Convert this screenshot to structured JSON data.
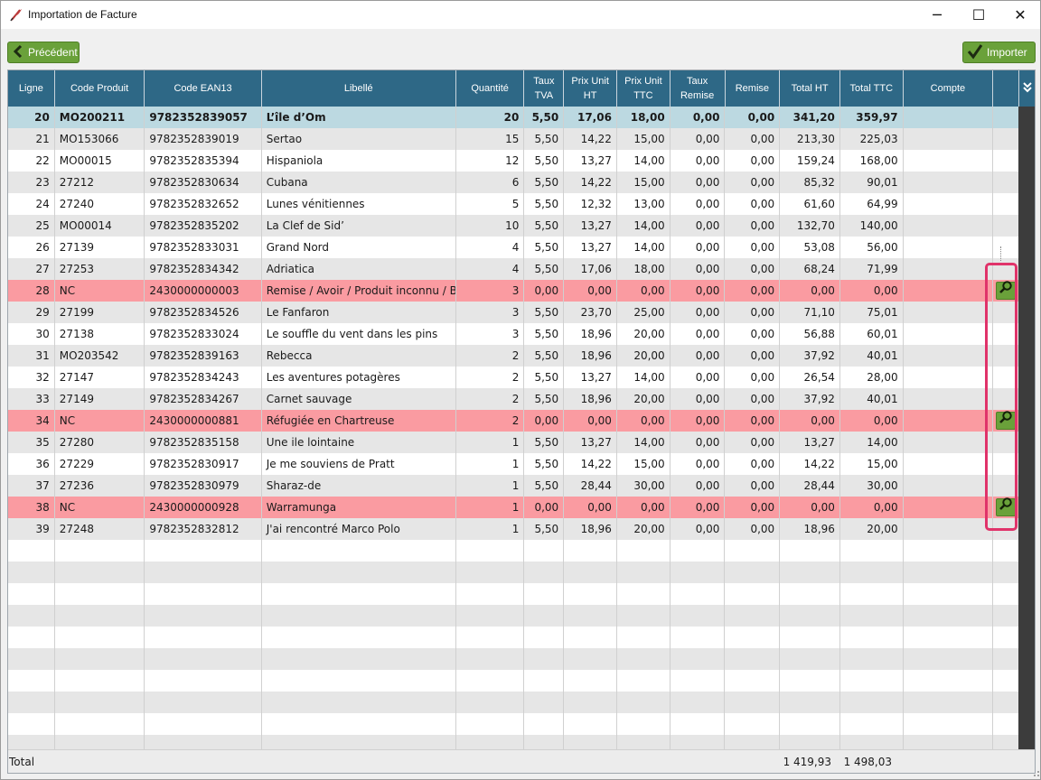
{
  "window": {
    "title": "Importation de Facture",
    "minimize": "─",
    "maximize": "☐",
    "close": "✕"
  },
  "toolbar": {
    "prev_label": "Précédent",
    "import_label": "Importer"
  },
  "colors": {
    "header": "#2e6886",
    "accent_green": "#6aa13a",
    "row_unknown": "#fa9ba1",
    "row_selected": "#bcd9e1",
    "highlight": "#e0336a"
  },
  "grid": {
    "columns": [
      {
        "key": "ligne",
        "label": "Ligne"
      },
      {
        "key": "code",
        "label": "Code Produit"
      },
      {
        "key": "ean",
        "label": "Code EAN13"
      },
      {
        "key": "libelle",
        "label": "Libellé"
      },
      {
        "key": "qte",
        "label": "Quantité"
      },
      {
        "key": "tva",
        "label": "Taux TVA"
      },
      {
        "key": "puht",
        "label": "Prix Unit HT"
      },
      {
        "key": "puttc",
        "label": "Prix Unit TTC"
      },
      {
        "key": "tremise",
        "label": "Taux Remise"
      },
      {
        "key": "remise",
        "label": "Remise"
      },
      {
        "key": "tht",
        "label": "Total HT"
      },
      {
        "key": "tttc",
        "label": "Total TTC"
      },
      {
        "key": "compte",
        "label": "Compte"
      },
      {
        "key": "action",
        "label": ""
      }
    ],
    "rows": [
      {
        "ligne": "20",
        "code": "MO200211",
        "ean": "9782352839057",
        "libelle": "L’île d’Om",
        "qte": "20",
        "tva": "5,50",
        "puht": "17,06",
        "puttc": "18,00",
        "tremise": "0,00",
        "remise": "0,00",
        "tht": "341,20",
        "tttc": "359,97",
        "compte": "",
        "state": "selected",
        "search": false
      },
      {
        "ligne": "21",
        "code": "MO153066",
        "ean": "9782352839019",
        "libelle": "Sertao",
        "qte": "15",
        "tva": "5,50",
        "puht": "14,22",
        "puttc": "15,00",
        "tremise": "0,00",
        "remise": "0,00",
        "tht": "213,30",
        "tttc": "225,03",
        "compte": "",
        "state": "normal",
        "search": false
      },
      {
        "ligne": "22",
        "code": "MO00015",
        "ean": "9782352835394",
        "libelle": "Hispaniola",
        "qte": "12",
        "tva": "5,50",
        "puht": "13,27",
        "puttc": "14,00",
        "tremise": "0,00",
        "remise": "0,00",
        "tht": "159,24",
        "tttc": "168,00",
        "compte": "",
        "state": "normal",
        "search": false
      },
      {
        "ligne": "23",
        "code": "27212",
        "ean": "9782352830634",
        "libelle": "Cubana",
        "qte": "6",
        "tva": "5,50",
        "puht": "14,22",
        "puttc": "15,00",
        "tremise": "0,00",
        "remise": "0,00",
        "tht": "85,32",
        "tttc": "90,01",
        "compte": "",
        "state": "normal",
        "search": false
      },
      {
        "ligne": "24",
        "code": "27240",
        "ean": "9782352832652",
        "libelle": "Lunes vénitiennes",
        "qte": "5",
        "tva": "5,50",
        "puht": "12,32",
        "puttc": "13,00",
        "tremise": "0,00",
        "remise": "0,00",
        "tht": "61,60",
        "tttc": "64,99",
        "compte": "",
        "state": "normal",
        "search": false
      },
      {
        "ligne": "25",
        "code": "MO00014",
        "ean": "9782352835202",
        "libelle": "La Clef de Sid’",
        "qte": "10",
        "tva": "5,50",
        "puht": "13,27",
        "puttc": "14,00",
        "tremise": "0,00",
        "remise": "0,00",
        "tht": "132,70",
        "tttc": "140,00",
        "compte": "",
        "state": "normal",
        "search": false
      },
      {
        "ligne": "26",
        "code": "27139",
        "ean": "9782352833031",
        "libelle": "Grand Nord",
        "qte": "4",
        "tva": "5,50",
        "puht": "13,27",
        "puttc": "14,00",
        "tremise": "0,00",
        "remise": "0,00",
        "tht": "53,08",
        "tttc": "56,00",
        "compte": "",
        "state": "normal",
        "search": false
      },
      {
        "ligne": "27",
        "code": "27253",
        "ean": "9782352834342",
        "libelle": "Adriatica",
        "qte": "4",
        "tva": "5,50",
        "puht": "17,06",
        "puttc": "18,00",
        "tremise": "0,00",
        "remise": "0,00",
        "tht": "68,24",
        "tttc": "71,99",
        "compte": "",
        "state": "normal",
        "search": false
      },
      {
        "ligne": "28",
        "code": "NC",
        "ean": "2430000000003",
        "libelle": "Remise / Avoir / Produit inconnu / Bo",
        "qte": "3",
        "tva": "0,00",
        "puht": "0,00",
        "puttc": "0,00",
        "tremise": "0,00",
        "remise": "0,00",
        "tht": "0,00",
        "tttc": "0,00",
        "compte": "",
        "state": "unknown",
        "search": true
      },
      {
        "ligne": "29",
        "code": "27199",
        "ean": "9782352834526",
        "libelle": "Le Fanfaron",
        "qte": "3",
        "tva": "5,50",
        "puht": "23,70",
        "puttc": "25,00",
        "tremise": "0,00",
        "remise": "0,00",
        "tht": "71,10",
        "tttc": "75,01",
        "compte": "",
        "state": "normal",
        "search": false
      },
      {
        "ligne": "30",
        "code": "27138",
        "ean": "9782352833024",
        "libelle": "Le souffle du vent dans les pins",
        "qte": "3",
        "tva": "5,50",
        "puht": "18,96",
        "puttc": "20,00",
        "tremise": "0,00",
        "remise": "0,00",
        "tht": "56,88",
        "tttc": "60,01",
        "compte": "",
        "state": "normal",
        "search": false
      },
      {
        "ligne": "31",
        "code": "MO203542",
        "ean": "9782352839163",
        "libelle": "Rebecca",
        "qte": "2",
        "tva": "5,50",
        "puht": "18,96",
        "puttc": "20,00",
        "tremise": "0,00",
        "remise": "0,00",
        "tht": "37,92",
        "tttc": "40,01",
        "compte": "",
        "state": "normal",
        "search": false
      },
      {
        "ligne": "32",
        "code": "27147",
        "ean": "9782352834243",
        "libelle": "Les aventures potagères",
        "qte": "2",
        "tva": "5,50",
        "puht": "13,27",
        "puttc": "14,00",
        "tremise": "0,00",
        "remise": "0,00",
        "tht": "26,54",
        "tttc": "28,00",
        "compte": "",
        "state": "normal",
        "search": false
      },
      {
        "ligne": "33",
        "code": "27149",
        "ean": "9782352834267",
        "libelle": "Carnet sauvage",
        "qte": "2",
        "tva": "5,50",
        "puht": "18,96",
        "puttc": "20,00",
        "tremise": "0,00",
        "remise": "0,00",
        "tht": "37,92",
        "tttc": "40,01",
        "compte": "",
        "state": "normal",
        "search": false
      },
      {
        "ligne": "34",
        "code": "NC",
        "ean": "2430000000881",
        "libelle": "Réfugiée en Chartreuse",
        "qte": "2",
        "tva": "0,00",
        "puht": "0,00",
        "puttc": "0,00",
        "tremise": "0,00",
        "remise": "0,00",
        "tht": "0,00",
        "tttc": "0,00",
        "compte": "",
        "state": "unknown",
        "search": true
      },
      {
        "ligne": "35",
        "code": "27280",
        "ean": "9782352835158",
        "libelle": "Une ile lointaine",
        "qte": "1",
        "tva": "5,50",
        "puht": "13,27",
        "puttc": "14,00",
        "tremise": "0,00",
        "remise": "0,00",
        "tht": "13,27",
        "tttc": "14,00",
        "compte": "",
        "state": "normal",
        "search": false
      },
      {
        "ligne": "36",
        "code": "27229",
        "ean": "9782352830917",
        "libelle": "Je me souviens de Pratt",
        "qte": "1",
        "tva": "5,50",
        "puht": "14,22",
        "puttc": "15,00",
        "tremise": "0,00",
        "remise": "0,00",
        "tht": "14,22",
        "tttc": "15,00",
        "compte": "",
        "state": "normal",
        "search": false
      },
      {
        "ligne": "37",
        "code": "27236",
        "ean": "9782352830979",
        "libelle": "Sharaz-de",
        "qte": "1",
        "tva": "5,50",
        "puht": "28,44",
        "puttc": "30,00",
        "tremise": "0,00",
        "remise": "0,00",
        "tht": "28,44",
        "tttc": "30,00",
        "compte": "",
        "state": "normal",
        "search": false
      },
      {
        "ligne": "38",
        "code": "NC",
        "ean": "2430000000928",
        "libelle": "Warramunga",
        "qte": "1",
        "tva": "0,00",
        "puht": "0,00",
        "puttc": "0,00",
        "tremise": "0,00",
        "remise": "0,00",
        "tht": "0,00",
        "tttc": "0,00",
        "compte": "",
        "state": "unknown",
        "search": true
      },
      {
        "ligne": "39",
        "code": "27248",
        "ean": "9782352832812",
        "libelle": "J'ai rencontré Marco Polo",
        "qte": "1",
        "tva": "5,50",
        "puht": "18,96",
        "puttc": "20,00",
        "tremise": "0,00",
        "remise": "0,00",
        "tht": "18,96",
        "tttc": "20,00",
        "compte": "",
        "state": "normal",
        "search": false
      }
    ],
    "empty_rows": 10,
    "total": {
      "label": "Total",
      "ht": "1 419,93",
      "ttc": "1 498,03"
    }
  }
}
